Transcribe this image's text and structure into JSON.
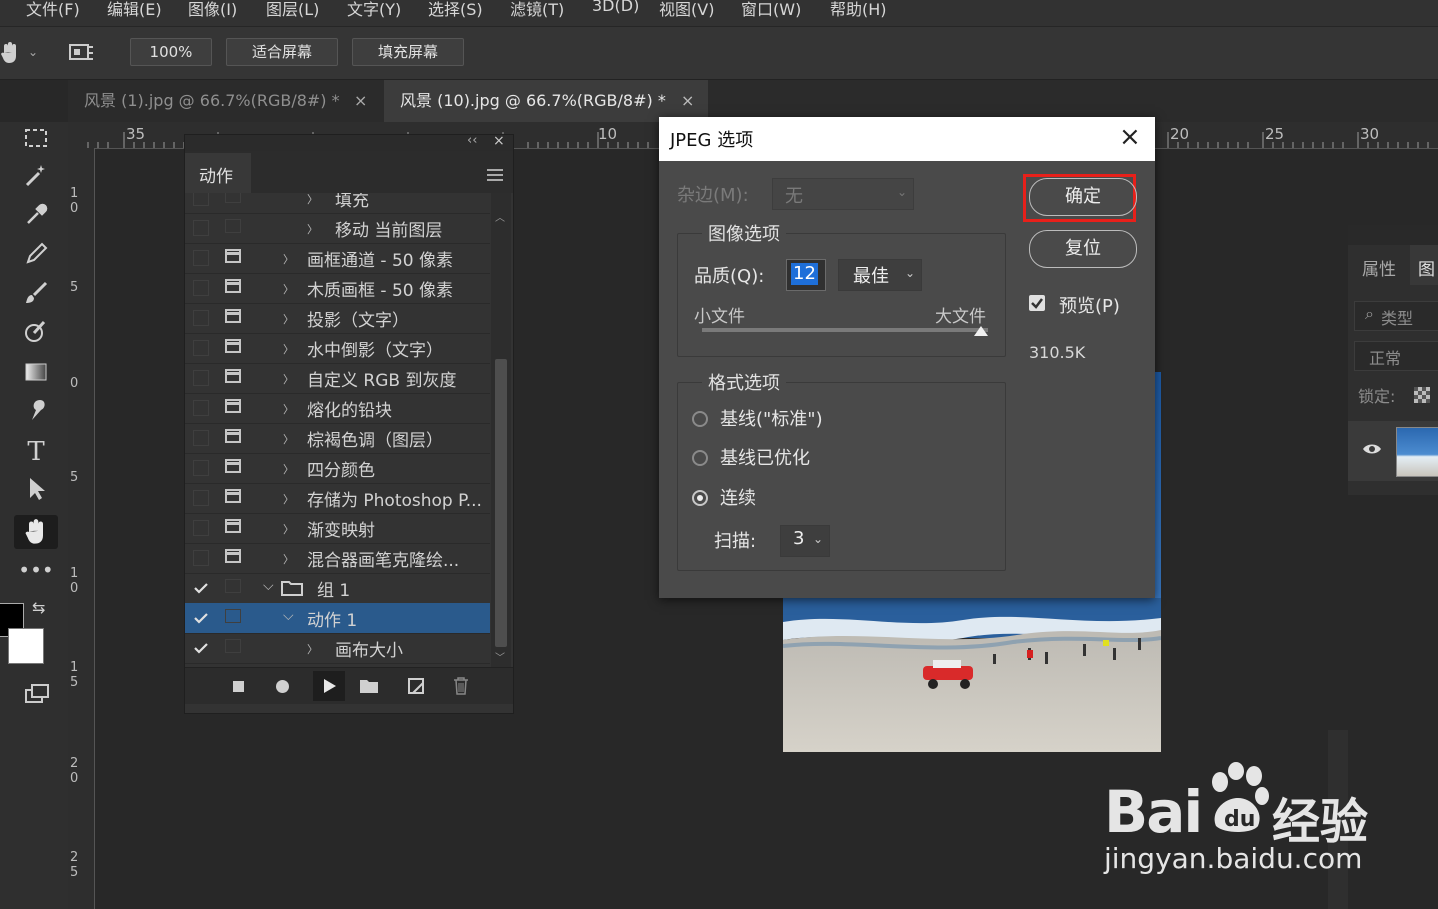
{
  "menu": {
    "items": [
      "文件(F)",
      "编辑(E)",
      "图像(I)",
      "图层(L)",
      "文字(Y)",
      "选择(S)",
      "滤镜(T)",
      "3D(D)",
      "视图(V)",
      "窗口(W)",
      "帮助(H)"
    ]
  },
  "options_bar": {
    "zoom_value": "100%",
    "fit_screen": "适合屏幕",
    "fill_screen": "填充屏幕"
  },
  "tabs": [
    {
      "label": "风景 (1).jpg @ 66.7%(RGB/8#) *",
      "close": "×"
    },
    {
      "label": "风景 (10).jpg @ 66.7%(RGB/8#) *",
      "close": "×"
    }
  ],
  "ruler": {
    "top": [
      "35",
      "10",
      "20",
      "25",
      "30"
    ],
    "left": [
      "1 0",
      "5",
      "0",
      "5",
      "1 0",
      "1 5",
      "2 0",
      "2 5"
    ]
  },
  "actions_panel": {
    "title": "动作",
    "collapse": "‹‹",
    "close": "×",
    "rows": [
      {
        "label": "填充",
        "indent": 2,
        "checked": false,
        "dialog": false
      },
      {
        "label": "移动 当前图层",
        "indent": 2,
        "checked": false,
        "dialog": false
      },
      {
        "label": "画框通道 - 50 像素",
        "indent": 1,
        "checked": false,
        "dialog": true
      },
      {
        "label": "木质画框 - 50 像素",
        "indent": 1,
        "checked": false,
        "dialog": true
      },
      {
        "label": "投影（文字）",
        "indent": 1,
        "checked": false,
        "dialog": true
      },
      {
        "label": "水中倒影（文字）",
        "indent": 1,
        "checked": false,
        "dialog": true
      },
      {
        "label": "自定义 RGB 到灰度",
        "indent": 1,
        "checked": false,
        "dialog": true
      },
      {
        "label": "熔化的铅块",
        "indent": 1,
        "checked": false,
        "dialog": true
      },
      {
        "label": "棕褐色调（图层）",
        "indent": 1,
        "checked": false,
        "dialog": true
      },
      {
        "label": "四分颜色",
        "indent": 1,
        "checked": false,
        "dialog": true
      },
      {
        "label": "存储为 Photoshop P...",
        "indent": 1,
        "checked": false,
        "dialog": true
      },
      {
        "label": "渐变映射",
        "indent": 1,
        "checked": false,
        "dialog": true
      },
      {
        "label": "混合器画笔克隆绘...",
        "indent": 1,
        "checked": false,
        "dialog": true
      },
      {
        "label": "组 1",
        "indent": 0,
        "checked": true,
        "dialog": false
      },
      {
        "label": "动作 1",
        "indent": 1,
        "checked": true,
        "dialog": false
      },
      {
        "label": "画布大小",
        "indent": 2,
        "checked": true,
        "dialog": false
      }
    ]
  },
  "dialog": {
    "title": "JPEG 选项",
    "close": "×",
    "matte_label": "杂边(M):",
    "matte_value": "无",
    "image_options": "图像选项",
    "quality_label": "品质(Q):",
    "quality_value": "12",
    "quality_preset": "最佳",
    "small_file": "小文件",
    "large_file": "大文件",
    "quality_level": 1.0,
    "format_options": "格式选项",
    "format_baseline_std": "基线(\"标准\")",
    "format_baseline_opt": "基线已优化",
    "format_progressive": "连续",
    "scans_label": "扫描:",
    "scans_value": "3",
    "ok": "确定",
    "reset": "复位",
    "preview_label": "预览(P)",
    "file_size": "310.5K"
  },
  "right_panel": {
    "properties_tab": "属性",
    "layers_tab": "图",
    "kind": "类型",
    "blend_mode": "正常",
    "lock_label": "锁定:"
  },
  "watermark": {
    "brand": "Bai",
    "brand_cn": "经验",
    "url": "jingyan.baidu.com"
  },
  "colors": {
    "highlight_red": "#e8201a",
    "selection_blue": "#2a5a8c",
    "dialog_bg": "#4a4a4a"
  }
}
